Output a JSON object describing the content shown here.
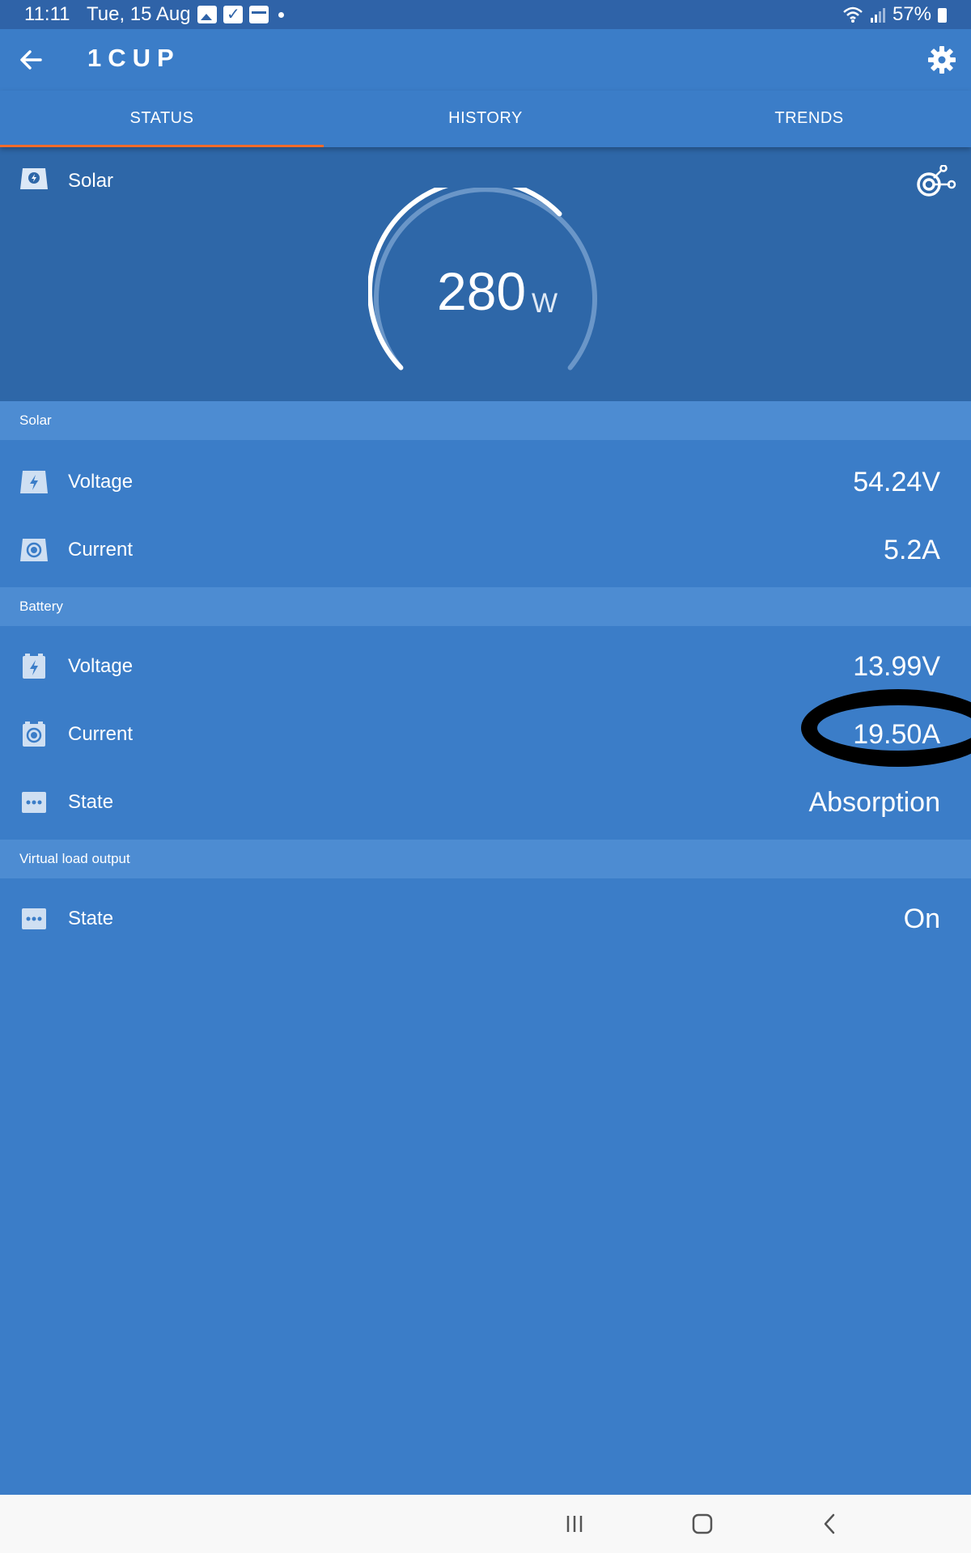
{
  "status_bar": {
    "time": "11:11",
    "date": "Tue, 15 Aug",
    "battery": "57%",
    "icons": [
      "gallery-icon",
      "check-icon",
      "calendar-icon",
      "wifi-icon",
      "signal-icon",
      "battery-icon"
    ]
  },
  "app_bar": {
    "title": "1CUP"
  },
  "tabs": [
    {
      "label": "STATUS",
      "active": true
    },
    {
      "label": "HISTORY",
      "active": false
    },
    {
      "label": "TRENDS",
      "active": false
    }
  ],
  "hero": {
    "label": "Solar",
    "value": "280",
    "unit": "W"
  },
  "sections": [
    {
      "title": "Solar",
      "rows": [
        {
          "label": "Voltage",
          "value": "54.24V",
          "icon": "bolt-icon"
        },
        {
          "label": "Current",
          "value": "5.2A",
          "icon": "current-icon"
        }
      ]
    },
    {
      "title": "Battery",
      "rows": [
        {
          "label": "Voltage",
          "value": "13.99V",
          "icon": "battery-bolt-icon"
        },
        {
          "label": "Current",
          "value": "19.50A",
          "icon": "current-icon"
        },
        {
          "label": "State",
          "value": "Absorption",
          "icon": "dots-icon"
        }
      ]
    },
    {
      "title": "Virtual load output",
      "rows": [
        {
          "label": "State",
          "value": "On",
          "icon": "dots-icon"
        }
      ]
    }
  ],
  "colors": {
    "background": "#3b7dc8",
    "status_bar": "#2f63a8",
    "hero": "#2e67a8",
    "section_header": "#4d8cd2",
    "tab_indicator": "#f26b2a"
  }
}
